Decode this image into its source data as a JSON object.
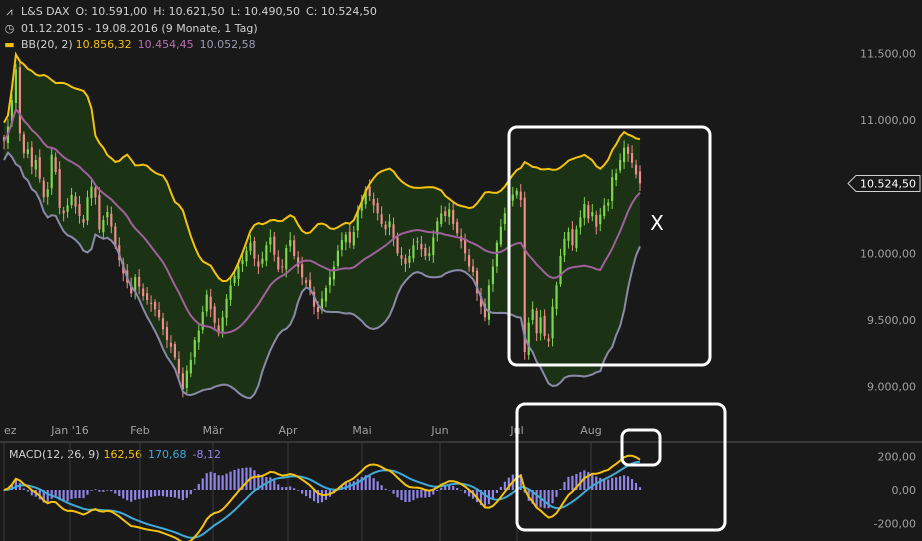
{
  "header": {
    "symbol": "L&S DAX",
    "ohlc": {
      "o": "O: 10.591,00",
      "h": "H: 10.621,50",
      "l": "L: 10.490,50",
      "c": "C: 10.524,50"
    },
    "period": "01.12.2015 - 19.08.2016 (9 Monate, 1 Tag)",
    "bb_label": "BB(20, 2)",
    "bb_values": [
      "10.856,32",
      "10.454,45",
      "10.052,58"
    ]
  },
  "macd_header": {
    "label": "MACD(12, 26, 9)",
    "values": [
      "162,56",
      "170,68",
      "-8,12"
    ]
  },
  "icons": [
    "chart-type-icon",
    "clock-icon"
  ],
  "colors": {
    "background": "#1a1919",
    "bb_upper": "#f4c20d",
    "bb_middle": "#a0609c",
    "bb_lower": "#8a8aa8",
    "band_fill": "#1c3515",
    "candle_up": "#7fd74f",
    "candle_down": "#f08c8c",
    "macd_line": "#f4c20d",
    "signal_line": "#3fa9d8",
    "histogram": "#9085e8",
    "annotation": "#ffffff"
  },
  "chart_data": [
    {
      "type": "candlestick",
      "title": "L&S DAX",
      "x_tick_labels": [
        "ez",
        "Jan '16",
        "Feb",
        "Mär",
        "Apr",
        "Mai",
        "Jun",
        "Jul",
        "Aug"
      ],
      "y_tick_labels": [
        "11.500,00",
        "11.000,00",
        "10.500,00",
        "10.000,00",
        "9.500,00",
        "9.000,00"
      ],
      "ylim": [
        8750,
        11750
      ],
      "last_price_label": "10.524,50",
      "close_series": [
        10840,
        10950,
        11150,
        11380,
        10900,
        10750,
        10780,
        10650,
        10700,
        10560,
        10420,
        10480,
        10740,
        10610,
        10340,
        10300,
        10360,
        10440,
        10350,
        10280,
        10230,
        10420,
        10500,
        10420,
        10180,
        10250,
        10310,
        10200,
        10050,
        9950,
        9850,
        9780,
        9700,
        9820,
        9750,
        9680,
        9650,
        9620,
        9580,
        9520,
        9430,
        9350,
        9300,
        9220,
        9100,
        8980,
        9120,
        9200,
        9350,
        9420,
        9560,
        9690,
        9580,
        9480,
        9400,
        9520,
        9660,
        9760,
        9830,
        9900,
        9950,
        10020,
        10080,
        9960,
        9900,
        9960,
        10060,
        10120,
        9990,
        9880,
        9900,
        10040,
        10100,
        9980,
        9900,
        9820,
        9780,
        9720,
        9600,
        9560,
        9660,
        9740,
        9820,
        9900,
        10020,
        10100,
        10140,
        10080,
        10160,
        10320,
        10380,
        10480,
        10430,
        10360,
        10300,
        10220,
        10180,
        10240,
        10100,
        10000,
        9960,
        9920,
        9980,
        10060,
        10090,
        10030,
        9980,
        10000,
        10120,
        10240,
        10300,
        10280,
        10330,
        10220,
        10150,
        10090,
        10000,
        9900,
        9860,
        9700,
        9600,
        9520,
        9760,
        9900,
        10080,
        10200,
        10300,
        10380,
        10440,
        10470,
        10400,
        9260,
        9480,
        9580,
        9400,
        9520,
        9380,
        9340,
        9600,
        9760,
        9980,
        10110,
        10160,
        10060,
        10180,
        10270,
        10370,
        10260,
        10310,
        10200,
        10290,
        10360,
        10380,
        10570,
        10600,
        10700,
        10792,
        10746,
        10680,
        10592,
        10524
      ],
      "bollinger": {
        "upper_last": 10856.32,
        "middle_last": 10454.45,
        "lower_last": 10052.58
      },
      "annotations": [
        {
          "label": "X"
        }
      ]
    },
    {
      "type": "line",
      "title": "MACD(12, 26, 9)",
      "y_tick_labels": [
        "200,00",
        "0,00",
        "-200,00"
      ],
      "ylim": [
        -270,
        270
      ],
      "series": [
        {
          "name": "MACD",
          "last": 162.56
        },
        {
          "name": "Signal",
          "last": 170.68
        },
        {
          "name": "Histogram",
          "last": -8.12
        }
      ]
    }
  ]
}
